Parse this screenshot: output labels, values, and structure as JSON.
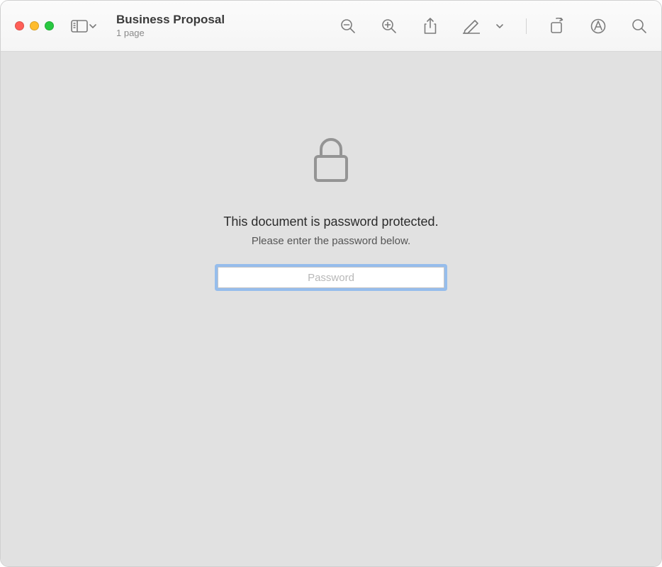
{
  "document": {
    "title": "Business Proposal",
    "subtitle": "1 page"
  },
  "protected": {
    "primary": "This document is password protected.",
    "secondary": "Please enter the password below.",
    "placeholder": "Password",
    "value": ""
  }
}
